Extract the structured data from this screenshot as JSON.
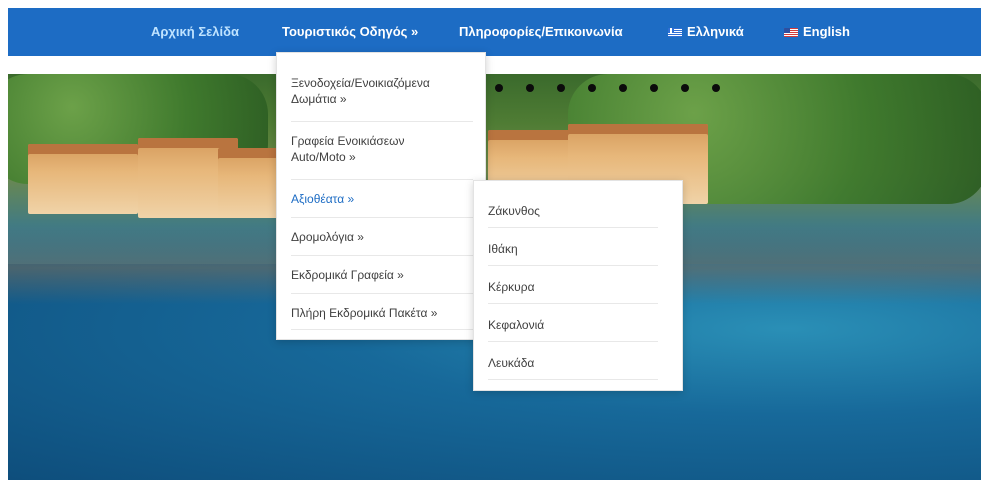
{
  "nav": {
    "items": [
      {
        "label": "Αρχική Σελίδα"
      },
      {
        "label": "Τουριστικός Οδηγός »"
      },
      {
        "label": "Πληροφορίες/Επικοινωνία"
      },
      {
        "label": "Ελληνικά",
        "icon": "greek-flag-icon"
      },
      {
        "label": "English",
        "icon": "english-flag-icon"
      }
    ],
    "colors": {
      "bar": "#1d6cc4",
      "active": "#bfe3ff"
    }
  },
  "dropdown": {
    "items": [
      {
        "label_line1": "Ξενοδοχεία/Ενοικιαζόμενα",
        "label_line2": "Δωμάτια »"
      },
      {
        "label_line1": "Γραφεία Ενοικιάσεων",
        "label_line2": "Auto/Moto »"
      },
      {
        "label": "Αξιοθέατα »"
      },
      {
        "label": "Δρομολόγια »"
      },
      {
        "label": "Εκδρομικά Γραφεία »"
      },
      {
        "label": "Πλήρη Εκδρομικά Πακέτα »"
      }
    ]
  },
  "submenu": {
    "items": [
      {
        "label": "Ζάκυνθος"
      },
      {
        "label": "Ιθάκη"
      },
      {
        "label": "Κέρκυρα"
      },
      {
        "label": "Κεφαλονιά"
      },
      {
        "label": "Λευκάδα"
      }
    ]
  }
}
